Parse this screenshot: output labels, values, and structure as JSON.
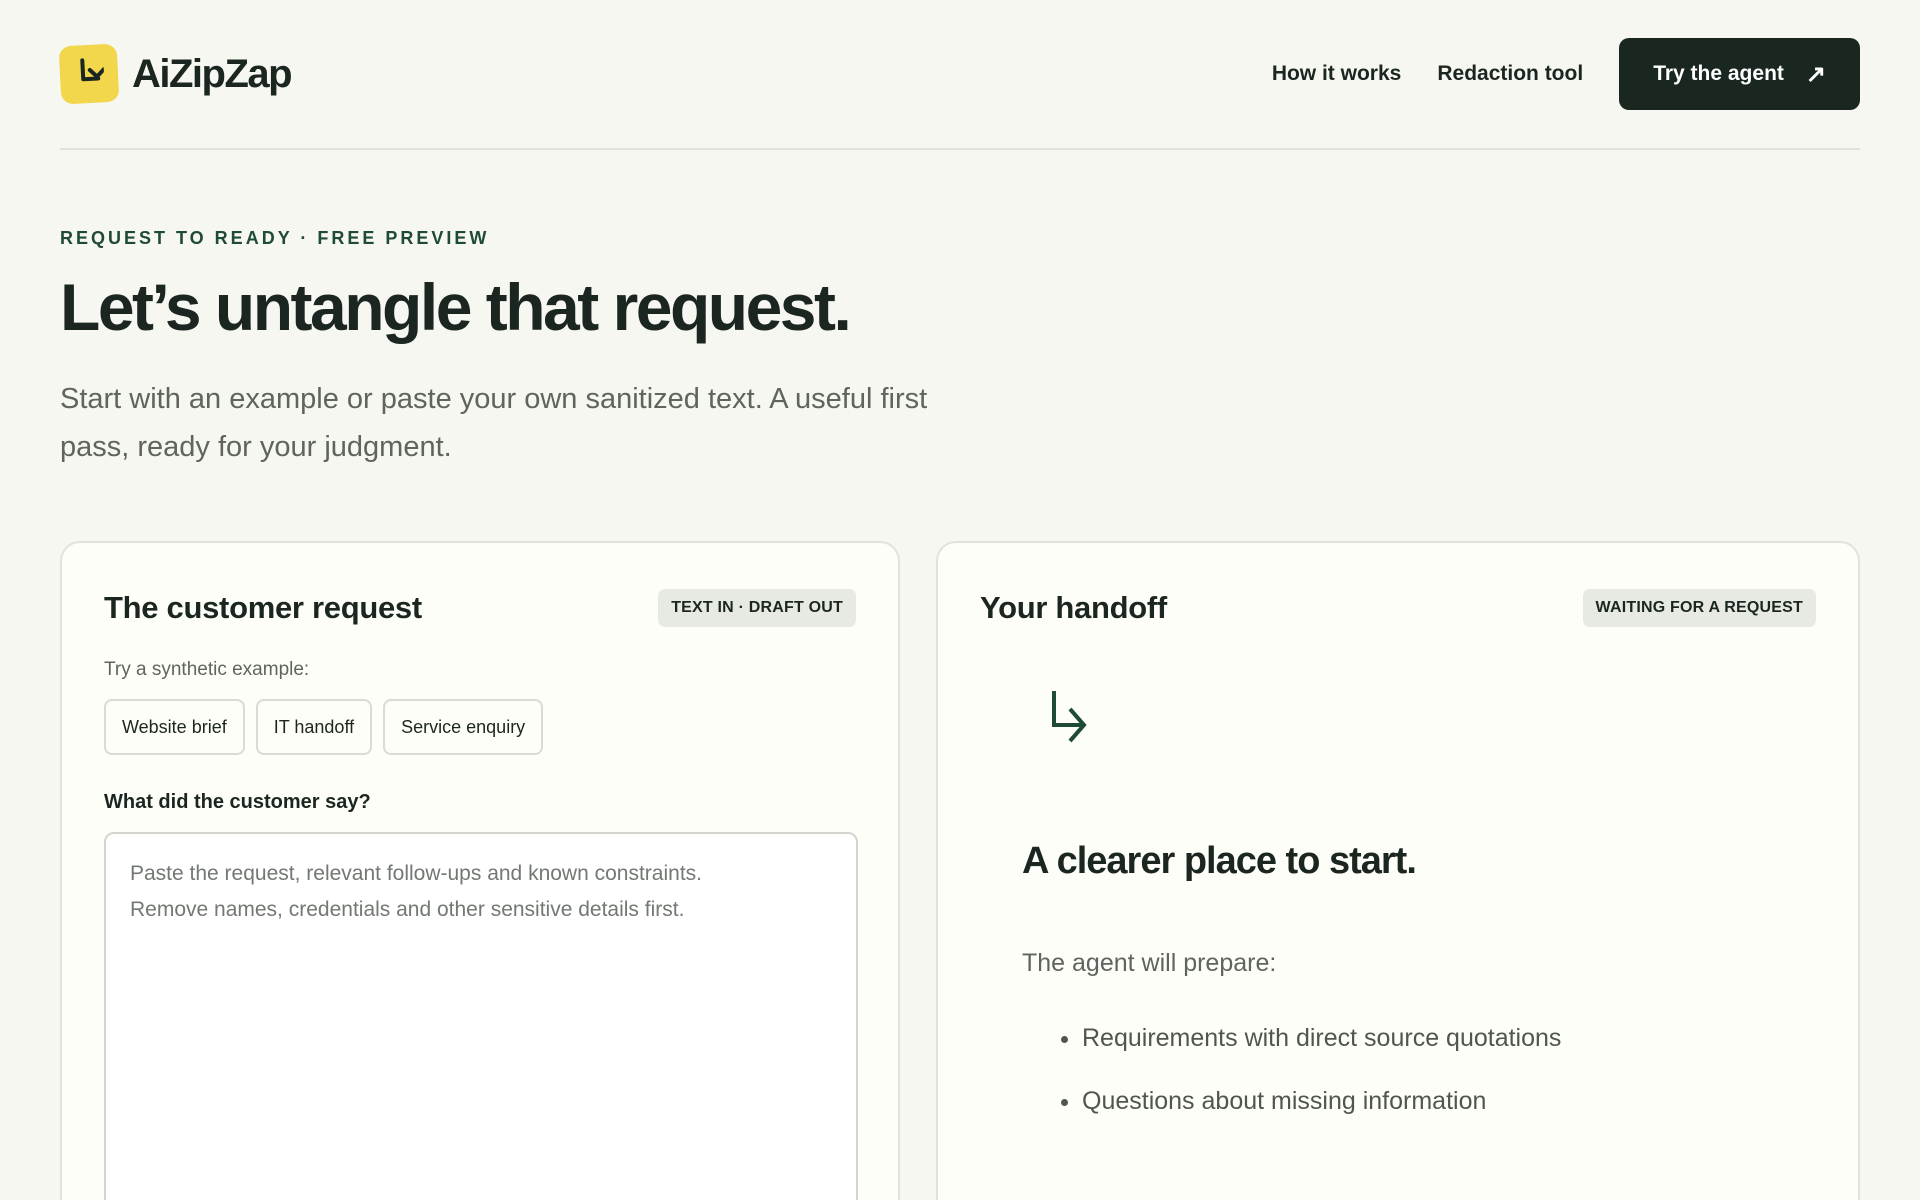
{
  "brand": {
    "name": "AiZipZap",
    "logo_color": "#f2d64b"
  },
  "nav": {
    "links": [
      "How it works",
      "Redaction tool"
    ],
    "cta_label": "Try the agent",
    "cta_icon": "arrow-up-right-icon"
  },
  "hero": {
    "eyebrow": "REQUEST TO READY · FREE PREVIEW",
    "title": "Let’s untangle that request.",
    "subtitle": "Start with an example or paste your own sanitized text. A useful first pass, ready for your judgment."
  },
  "request_panel": {
    "title": "The customer request",
    "badge": "TEXT IN · DRAFT OUT",
    "examples_label": "Try a synthetic example:",
    "examples": [
      "Website brief",
      "IT handoff",
      "Service enquiry"
    ],
    "field_label": "What did the customer say?",
    "placeholder": "Paste the request, relevant follow-ups and known constraints.\nRemove names, credentials and other sensitive details first.",
    "value": ""
  },
  "handoff_panel": {
    "title": "Your handoff",
    "badge": "WAITING FOR A REQUEST",
    "icon": "arrow-down-right-icon",
    "empty_title": "A clearer place to start.",
    "prepare_label": "The agent will prepare:",
    "items": [
      "Requirements with direct source quotations",
      "Questions about missing information"
    ]
  },
  "colors": {
    "background": "#f7f7f1",
    "accent_dark": "#1a2620",
    "accent_green": "#1f4a38",
    "logo_yellow": "#f2d64b"
  }
}
